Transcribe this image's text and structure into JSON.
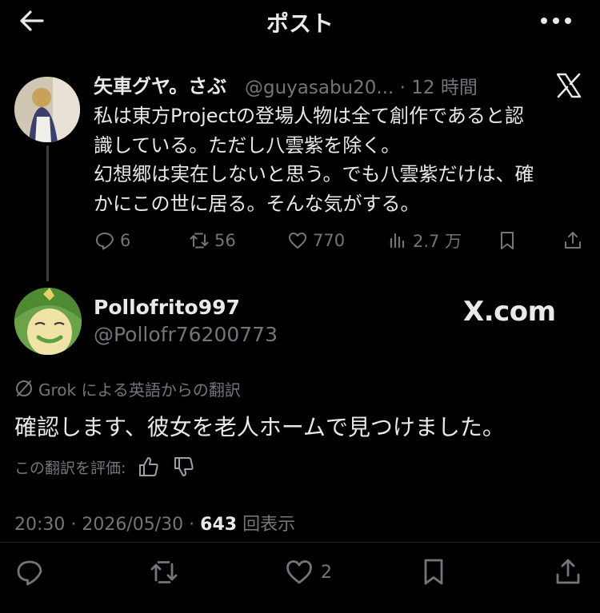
{
  "header": {
    "title": "ポスト",
    "back_icon": "arrow-left-icon",
    "more_icon": "more-horizontal-icon"
  },
  "parent_post": {
    "author_name": "矢車グヤ。さぶ",
    "handle": "@guyasabu20...",
    "time": "· 12 時間",
    "lines": [
      "私は東方Projectの登場人物は全て創作であると認",
      "識している。ただし八雲紫を除く。",
      "幻想郷は実在しないと思う。でも八雲紫だけは、確",
      "かにこの世に居る。そんな気がする。"
    ],
    "replies": "6",
    "reposts": "56",
    "likes": "770",
    "views": "2.7 万"
  },
  "post": {
    "author_name": "Pollofrito997",
    "handle": "@Pollofr76200773",
    "watermark": "X.com",
    "translation_note": "Grok による英語からの翻訳",
    "text": "確認します、彼女を老人ホームで見つけました。",
    "rate_label": "この翻訳を評価:",
    "meta_prefix": "20:30 · 2026/05/30 · ",
    "view_count": "643",
    "view_suffix": " 回表示",
    "likes": "2"
  },
  "colors": {
    "background": "#000000",
    "text": "#e7e9ea",
    "muted": "#71767b"
  }
}
